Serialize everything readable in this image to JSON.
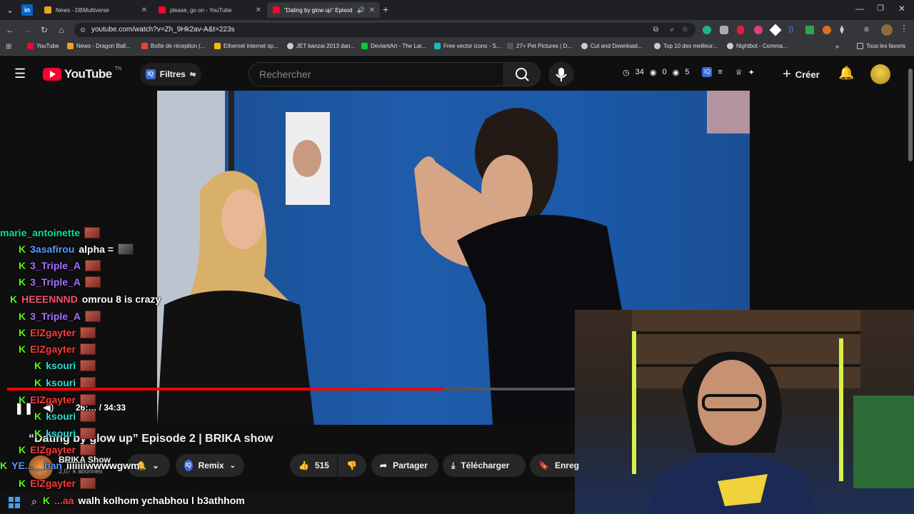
{
  "browser": {
    "tabs": [
      {
        "label": "News - DBMultiverse",
        "active": false
      },
      {
        "label": "please, go on - YouTube",
        "active": false
      },
      {
        "label": "“Dating by glow up” Episod",
        "active": true
      }
    ],
    "url": "youtube.com/watch?v=Zh_9Hk2av-A&t=223s",
    "bookmarks": [
      "YouTube",
      "News - Dragon Ball...",
      "Boîte de réception (...",
      "Ethernet internet sp...",
      "JET banzai 2013 dan...",
      "DeviantArt - The Lar...",
      "Free vector icons - S...",
      "27+ Pet Pictures | D...",
      "Cut and Download...",
      "Top 10 des meilleur...",
      "Nightbot - Comma..."
    ],
    "all_bookmarks": "Tous les favoris"
  },
  "yt": {
    "logo": "YouTube",
    "logo_sup": "TN",
    "filtres": "Filtres",
    "search_placeholder": "Rechercher",
    "stats": {
      "a": "34",
      "b": "0",
      "c": "5"
    },
    "create": "Créer"
  },
  "player": {
    "time": "26:… / 34:33",
    "progress": 0.77
  },
  "video": {
    "title": "“Dating by glow up” Episode 2 | BRIKA show",
    "channel": "BRIKA Show",
    "subs": "2,07 k abonnés",
    "remix": "Remix",
    "likes": "515",
    "share": "Partager",
    "download": "Télécharger",
    "save": "Enreg"
  },
  "chat": [
    {
      "user": "marie_antoinette",
      "color": "#00e5a0",
      "msg": "",
      "kick": false,
      "emote": "red"
    },
    {
      "user": "3asafirou",
      "color": "#5b9bff",
      "msg": "alpha =",
      "kick": true,
      "emote": "grey"
    },
    {
      "user": "3_Triple_A",
      "color": "#a970ff",
      "msg": "",
      "kick": true,
      "emote": "red"
    },
    {
      "user": "3_Triple_A",
      "color": "#a970ff",
      "msg": "",
      "kick": true,
      "emote": "red"
    },
    {
      "user": "HEEENNND",
      "color": "#ff4f6d",
      "msg": "omrou 8 is crazy",
      "kick": true,
      "emote": ""
    },
    {
      "user": "3_Triple_A",
      "color": "#a970ff",
      "msg": "",
      "kick": true,
      "emote": "red"
    },
    {
      "user": "ElZgayter",
      "color": "#ff3b3b",
      "msg": "",
      "kick": true,
      "emote": "red"
    },
    {
      "user": "ElZgayter",
      "color": "#ff3b3b",
      "msg": "",
      "kick": true,
      "emote": "red"
    },
    {
      "user": "ksouri",
      "color": "#2ee0d0",
      "msg": "",
      "kick": true,
      "emote": "red"
    },
    {
      "user": "ksouri",
      "color": "#2ee0d0",
      "msg": "",
      "kick": true,
      "emote": "red"
    },
    {
      "user": "ElZgayter",
      "color": "#ff3b3b",
      "msg": "",
      "kick": true,
      "emote": "red"
    },
    {
      "user": "ksouri",
      "color": "#2ee0d0",
      "msg": "",
      "kick": true,
      "emote": "red"
    },
    {
      "user": "ksouri",
      "color": "#2ee0d0",
      "msg": "",
      "kick": true,
      "emote": "red"
    },
    {
      "user": "ElZgayter",
      "color": "#ff3b3b",
      "msg": "",
      "kick": true,
      "emote": "red"
    },
    {
      "user": "YE...__ban",
      "color": "#5b9bff",
      "msg": "iiiiiiiwwwwgwm",
      "kick": true,
      "emote": ""
    },
    {
      "user": "ElZgayter",
      "color": "#ff3b3b",
      "msg": "",
      "kick": true,
      "emote": "red"
    },
    {
      "user": "...aa",
      "color": "#ff3b3b",
      "msg": "walh kolhom ychabhou l b3athhom",
      "kick": true,
      "emote": ""
    }
  ]
}
